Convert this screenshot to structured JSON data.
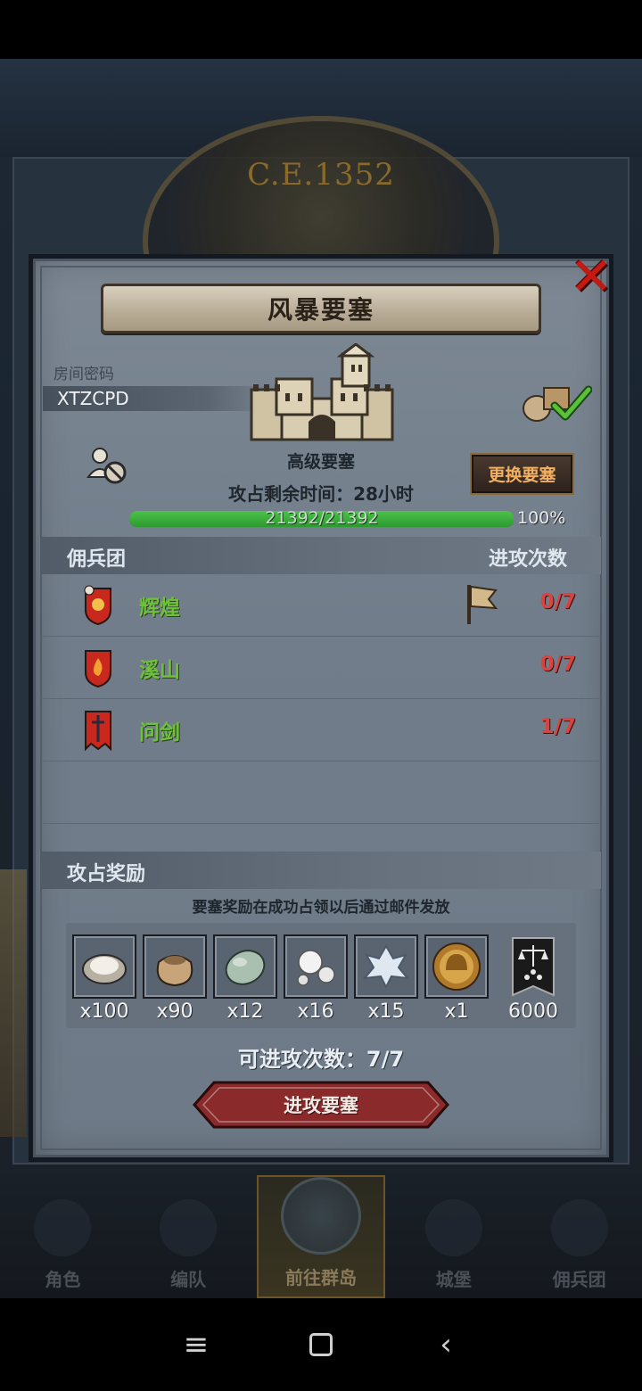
{
  "background": {
    "era_text": "C.E.1352"
  },
  "modal": {
    "title": "风暴要塞",
    "room_label": "房间密码",
    "room_code": "XTZCPD",
    "fort_type": "高级要塞",
    "time_remaining": "攻占剩余时间：28小时",
    "change_button": "更换要塞",
    "hp_text": "21392/21392",
    "hp_percent_text": "100%",
    "hp_fraction": 1.0,
    "mercenary_header": "佣兵团",
    "attacks_header": "进攻次数",
    "guilds": [
      {
        "name": "辉煌",
        "count": "0/7",
        "emblem": "sun-shield-icon",
        "flag": true
      },
      {
        "name": "溪山",
        "count": "0/7",
        "emblem": "fire-shield-icon",
        "flag": false
      },
      {
        "name": "问剑",
        "count": "1/7",
        "emblem": "sword-banner-icon",
        "flag": false
      }
    ],
    "reward_header": "攻占奖励",
    "reward_note": "要塞奖励在成功占领以后通过邮件发放",
    "rewards": [
      {
        "icon": "oyster-icon",
        "qty": "x100"
      },
      {
        "icon": "sack-icon",
        "qty": "x90"
      },
      {
        "icon": "stone-icon",
        "qty": "x12"
      },
      {
        "icon": "pearl-icon",
        "qty": "x16"
      },
      {
        "icon": "crystal-icon",
        "qty": "x15"
      },
      {
        "icon": "helmet-medal-icon",
        "qty": "x1"
      },
      {
        "icon": "justice-banner-icon",
        "qty": "6000"
      }
    ],
    "attack_count": "可进攻次数：7/7",
    "attack_button": "进攻要塞"
  },
  "bottom_nav": [
    {
      "label": "角色",
      "active": false
    },
    {
      "label": "编队",
      "active": false
    },
    {
      "label": "前往群岛",
      "active": true
    },
    {
      "label": "城堡",
      "active": false
    },
    {
      "label": "佣兵团",
      "active": false
    }
  ],
  "colors": {
    "guild_name": "#6ec23a",
    "attack_count_red": "#d9453e",
    "hp_green": "#2c9a30",
    "close_red": "#c41a12"
  }
}
